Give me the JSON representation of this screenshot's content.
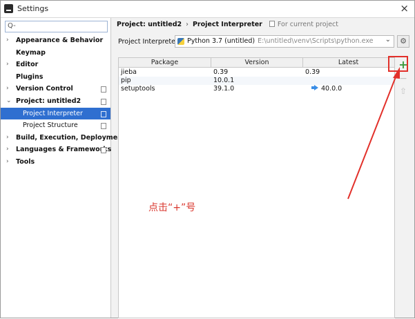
{
  "window": {
    "title": "Settings",
    "close_symbol": "×"
  },
  "sidebar": {
    "search_placeholder": "",
    "search_symbol": "Q-",
    "items": [
      {
        "label": "Appearance & Behavior",
        "arrow": "›",
        "level": 0,
        "selected": false,
        "has_doc_icon": false
      },
      {
        "label": "Keymap",
        "arrow": "",
        "level": 0,
        "selected": false,
        "has_doc_icon": false
      },
      {
        "label": "Editor",
        "arrow": "›",
        "level": 0,
        "selected": false,
        "has_doc_icon": false
      },
      {
        "label": "Plugins",
        "arrow": "",
        "level": 0,
        "selected": false,
        "has_doc_icon": false
      },
      {
        "label": "Version Control",
        "arrow": "›",
        "level": 0,
        "selected": false,
        "has_doc_icon": true
      },
      {
        "label": "Project: untitled2",
        "arrow": "⌄",
        "level": 0,
        "selected": false,
        "has_doc_icon": true
      },
      {
        "label": "Project Interpreter",
        "arrow": "",
        "level": 1,
        "selected": true,
        "has_doc_icon": true
      },
      {
        "label": "Project Structure",
        "arrow": "",
        "level": 1,
        "selected": false,
        "has_doc_icon": true
      },
      {
        "label": "Build, Execution, Deployment",
        "arrow": "›",
        "level": 0,
        "selected": false,
        "has_doc_icon": false
      },
      {
        "label": "Languages & Frameworks",
        "arrow": "›",
        "level": 0,
        "selected": false,
        "has_doc_icon": true
      },
      {
        "label": "Tools",
        "arrow": "›",
        "level": 0,
        "selected": false,
        "has_doc_icon": false
      }
    ]
  },
  "breadcrumb": {
    "project": "Project: untitled2",
    "separator": "›",
    "page": "Project Interpreter",
    "hint": "For current project"
  },
  "interpreter": {
    "label": "Project Interpreter:",
    "name": "Python 3.7 (untitled)",
    "path": "E:\\untitled\\venv\\Scripts\\python.exe",
    "chevron": "⌄",
    "gear_symbol": "⚙"
  },
  "table": {
    "columns": [
      "Package",
      "Version",
      "Latest"
    ],
    "rows": [
      {
        "package": "jieba",
        "version": "0.39",
        "latest": "0.39",
        "upgrade": false
      },
      {
        "package": "pip",
        "version": "10.0.1",
        "latest": "",
        "upgrade": false
      },
      {
        "package": "setuptools",
        "version": "39.1.0",
        "latest": "40.0.0",
        "upgrade": true
      }
    ]
  },
  "tools": {
    "add": "+",
    "remove": "−",
    "upgrade": "⇧"
  },
  "annotation": {
    "text": "点击“+”号",
    "color": "#d9362d"
  },
  "colors": {
    "selection": "#2f6fd0",
    "highlight": "#e2302a",
    "add_green": "#3c9a3c",
    "upgrade_blue": "#3a8ee6"
  },
  "icons": {
    "app": "pycharm-icon",
    "search": "search-icon",
    "interpreter": "python-icon",
    "gear": "gear-icon",
    "add": "plus-icon",
    "remove": "minus-icon",
    "upgrade": "upgrade-arrow-icon"
  }
}
